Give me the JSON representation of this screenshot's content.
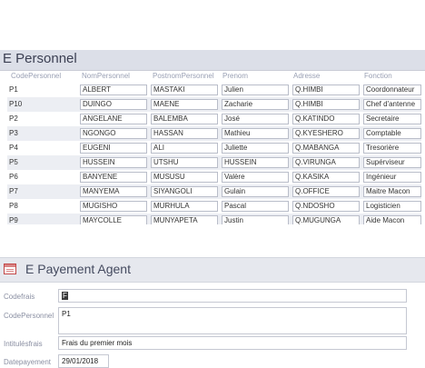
{
  "personnel": {
    "title": "E Personnel",
    "columns": [
      "CodePersonnel",
      "NomPersonnel",
      "PostnomPersonnel",
      "Prenom",
      "Adresse",
      "Fonction"
    ],
    "rows": [
      [
        "P1",
        "ALBERT",
        "MASTAKI",
        "Julien",
        "Q.HIMBI",
        "Coordonnateur"
      ],
      [
        "P10",
        "DUINGO",
        "MAENE",
        "Zacharie",
        "Q.HIMBI",
        "Chef d'antenne"
      ],
      [
        "P2",
        "ANGELANE",
        "BALEMBA",
        "José",
        "Q.KATINDO",
        "Secretaire"
      ],
      [
        "P3",
        "NGONGO",
        "HASSAN",
        "Mathieu",
        "Q.KYESHERO",
        "Comptable"
      ],
      [
        "P4",
        "EUGENI",
        "ALI",
        "Juliette",
        "Q.MABANGA",
        "Tresorière"
      ],
      [
        "P5",
        "HUSSEIN",
        "UTSHU",
        "HUSSEIN",
        "Q.VIRUNGA",
        "Supérviseur"
      ],
      [
        "P6",
        "BANYENE",
        "MUSUSU",
        "Valère",
        "Q.KASIKA",
        "Ingénieur"
      ],
      [
        "P7",
        "MANYEMA",
        "SIYANGOLI",
        "Gulain",
        "Q.OFFICE",
        "Maitre Macon"
      ],
      [
        "P8",
        "MUGISHO",
        "MURHULA",
        "Pascal",
        "Q.NDOSHO",
        "Logisticien"
      ],
      [
        "P9",
        "MAYCOLLE",
        "MUNYAPETA",
        "Justin",
        "Q.MUGUNGA",
        "Aide Macon"
      ]
    ]
  },
  "payement": {
    "title": "E Payement Agent",
    "fields": [
      {
        "label": "Codefrais",
        "value": "F"
      },
      {
        "label": "CodePersonnel",
        "value": "P1"
      },
      {
        "label": "Intitulésfrais",
        "value": "Frais du premier mois"
      },
      {
        "label": "Datepayement",
        "value": "29/01/2018"
      }
    ]
  }
}
